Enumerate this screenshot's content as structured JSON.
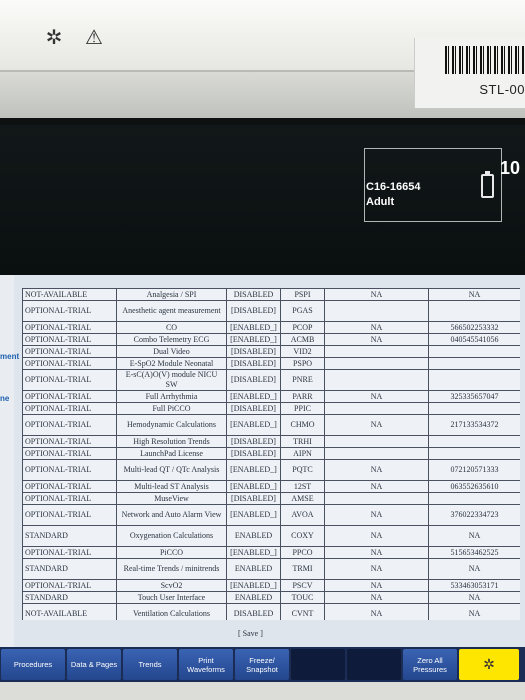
{
  "device_label": "STL-00",
  "patient": {
    "id": "C16-16654",
    "type": "Adult",
    "battery_number": "10"
  },
  "side_labels": [
    "ment",
    "ne"
  ],
  "cut_row": [
    "NOT AVAILABLE",
    "Analgesia / SPI",
    "DISABLED",
    "PSPI",
    "NA",
    "NA"
  ],
  "rows": [
    [
      "NOT-AVAILABLE",
      "Analgesia / SPI",
      "DISABLED",
      "PSPI",
      "NA",
      "NA"
    ],
    [
      "OPTIONAL-TRIAL",
      "Anesthetic agent measurement",
      "[DISABLED]",
      "PGAS",
      "",
      ""
    ],
    [
      "OPTIONAL-TRIAL",
      "CO",
      "[ENABLED_]",
      "PCOP",
      "NA",
      "566502253332"
    ],
    [
      "OPTIONAL-TRIAL",
      "Combo Telemetry ECG",
      "[ENABLED_]",
      "ACMB",
      "NA",
      "040545541056"
    ],
    [
      "OPTIONAL-TRIAL",
      "Dual Video",
      "[DISABLED]",
      "VID2",
      "",
      ""
    ],
    [
      "OPTIONAL-TRIAL",
      "E-SpO2 Module Neonatal",
      "[DISABLED]",
      "PSPO",
      "",
      ""
    ],
    [
      "OPTIONAL-TRIAL",
      "E-sC(A)O(V) module NICU SW",
      "[DISABLED]",
      "PNRE",
      "",
      ""
    ],
    [
      "OPTIONAL-TRIAL",
      "Full Arrhythmia",
      "[ENABLED_]",
      "PARR",
      "NA",
      "325335657047"
    ],
    [
      "OPTIONAL-TRIAL",
      "Full PiCCO",
      "[DISABLED]",
      "PPIC",
      "",
      ""
    ],
    [
      "OPTIONAL-TRIAL",
      "Hemodynamic Calculations",
      "[ENABLED_]",
      "CHMO",
      "NA",
      "217133534372"
    ],
    [
      "OPTIONAL-TRIAL",
      "High Resolution Trends",
      "[DISABLED]",
      "TRHI",
      "",
      ""
    ],
    [
      "OPTIONAL-TRIAL",
      "LaunchPad License",
      "[DISABLED]",
      "AIPN",
      "",
      ""
    ],
    [
      "OPTIONAL-TRIAL",
      "Multi-lead QT / QTc Analysis",
      "[ENABLED_]",
      "PQTC",
      "NA",
      "072120571333"
    ],
    [
      "OPTIONAL-TRIAL",
      "Multi-lead ST Analysis",
      "[ENABLED_]",
      "12ST",
      "NA",
      "063552635610"
    ],
    [
      "OPTIONAL-TRIAL",
      "MuseView",
      "[DISABLED]",
      "AMSE",
      "",
      ""
    ],
    [
      "OPTIONAL-TRIAL",
      "Network and Auto Alarm View",
      "[ENABLED_]",
      "AVOA",
      "NA",
      "376022334723"
    ],
    [
      "STANDARD",
      "Oxygenation Calculations",
      "ENABLED",
      "COXY",
      "NA",
      "NA"
    ],
    [
      "OPTIONAL-TRIAL",
      "PiCCO",
      "[ENABLED_]",
      "PPCO",
      "NA",
      "515653462525"
    ],
    [
      "STANDARD",
      "Real-time Trends / minitrends",
      "ENABLED",
      "TRMI",
      "NA",
      "NA"
    ],
    [
      "OPTIONAL-TRIAL",
      "ScvO2",
      "[ENABLED_]",
      "PSCV",
      "NA",
      "533463053171"
    ],
    [
      "STANDARD",
      "Touch User Interface",
      "ENABLED",
      "TOUC",
      "NA",
      "NA"
    ],
    [
      "NOT-AVAILABLE",
      "Ventilation Calculations",
      "DISABLED",
      "CVNT",
      "NA",
      "NA"
    ]
  ],
  "save_label": "[ Save ]",
  "toolbar": [
    {
      "label": "Procedures"
    },
    {
      "label": "Data & Pages"
    },
    {
      "label": "Trends"
    },
    {
      "label": "Print Waveforms"
    },
    {
      "label": "Freeze/ Snapshot"
    },
    {
      "label": ""
    },
    {
      "label": ""
    },
    {
      "label": "Zero All Pressures"
    },
    {
      "label": "alarm-silence"
    }
  ]
}
